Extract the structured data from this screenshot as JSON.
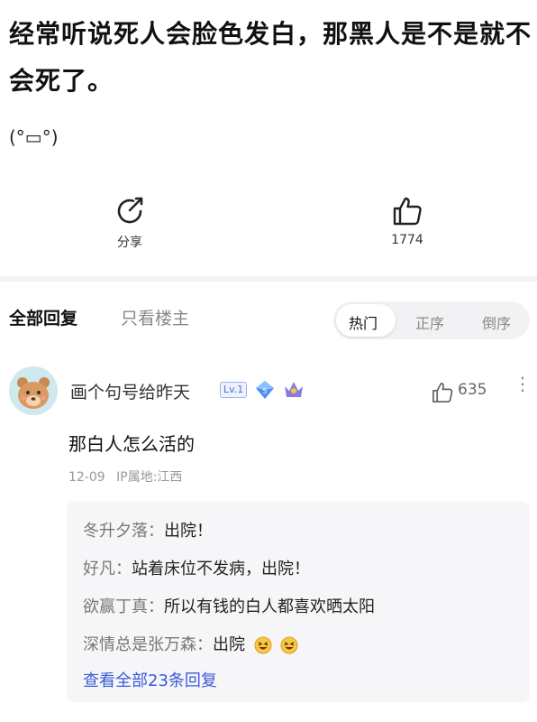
{
  "post": {
    "title": "经常听说死人会脸色发白，那黑人是不是就不会死了。",
    "kaomoji": "(°▭°)",
    "share_label": "分享",
    "like_count": "1774"
  },
  "tabs": {
    "all": "全部回复",
    "op_only": "只看楼主",
    "sort_options": [
      "热门",
      "正序",
      "倒序"
    ],
    "sort_selected": "热门"
  },
  "comment": {
    "username": "画个句号给昨天",
    "level": "Lv.1",
    "like_count": "635",
    "text": "那白人怎么活的",
    "date": "12-09",
    "ip": "IP属地:江西",
    "replies": [
      {
        "name": "冬升夕落",
        "text": "出院！"
      },
      {
        "name": "好凡",
        "text": "站着床位不发病，出院！"
      },
      {
        "name": "欲赢丁真",
        "text": "所以有钱的白人都喜欢晒太阳"
      },
      {
        "name": "深情总是张万森",
        "text": "出院"
      }
    ],
    "view_all": "查看全部23条回复"
  },
  "colors": {
    "accent": "#3b5bd6",
    "reply_bg": "#f6f6f8",
    "muted": "#999999"
  },
  "icons": [
    "share-icon",
    "thumbs-up-icon",
    "diamond-badge-icon",
    "crown-badge-icon",
    "more-vertical-icon",
    "grinning-emoji-icon"
  ]
}
